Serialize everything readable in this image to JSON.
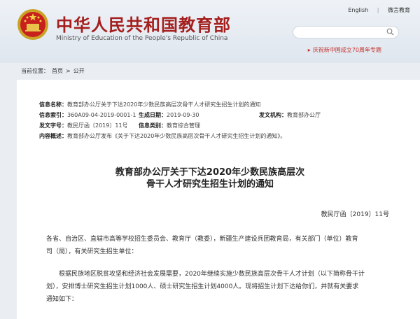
{
  "header": {
    "site_name": "中华人民共和国教育部",
    "site_name_en": "Ministry of Education of the People's Republic of China",
    "links": [
      "English",
      "|",
      "微言教育"
    ],
    "banner": "庆祝新中国成立70周年专题"
  },
  "breadcrumb": [
    "当前位置：",
    "首页",
    ">",
    "公开"
  ],
  "meta": {
    "info_name_label": "信息名称：",
    "info_name": "教育部办公厅关于下达2020年少数民族高层次骨干人才研究生招生计划的通知",
    "index_label": "信息索引：",
    "index": "360A09-04-2019-0001-1",
    "date_label": "生成日期：",
    "date": "2019-09-30",
    "issuer_label": "发文机构：",
    "issuer": "教育部办公厅",
    "docno_label": "发文字号：",
    "docno": "教民厅函〔2019〕11号",
    "category_label": "信息类别：",
    "category": "教育综合管理",
    "summary_label": "内容概述：",
    "summary": "教育部办公厅发布《关于下达2020年少数民族高层次骨干人才研究生招生计划的通知》。"
  },
  "document": {
    "title_line1": "教育部办公厅关于下达2020年少数民族高层次",
    "title_line2": "骨干人才研究生招生计划的通知",
    "doc_number": "教民厅函〔2019〕11号",
    "recipients_line1": "各省、自治区、直辖市高等学校招生委员会、教育厅（教委），新疆生产建设兵团教育局，有关部门（单位）教育",
    "recipients_line2": "司（局），有关研究生招生单位：",
    "body_line1": "根据民族地区脱贫攻坚和经济社会发展需要，2020年继续实施少数民族高层次骨干人才计划（以下简称骨干计",
    "body_line2": "划），安排博士研究生招生计划1000人、硕士研究生招生计划4000人。现将招生计划下达给你们，并就有关要求",
    "body_line3": "通知如下："
  }
}
